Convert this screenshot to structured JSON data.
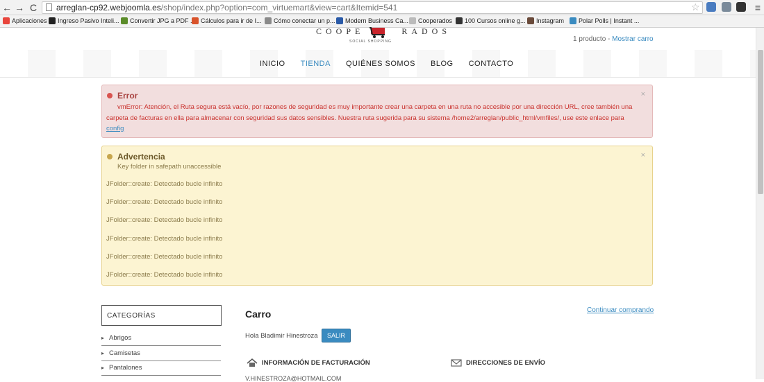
{
  "browser": {
    "url_host": "arreglan-cp92.webjoomla.es",
    "url_path": "/shop/index.php?option=com_virtuemart&view=cart&Itemid=541",
    "bookmarks": [
      {
        "label": "Aplicaciones",
        "color": "#e8453c"
      },
      {
        "label": "Ingreso Pasivo Inteli...",
        "color": "#222222"
      },
      {
        "label": "Convertir JPG a PDF ...",
        "color": "#5b8c2a"
      },
      {
        "label": "Cálculos para ir de I...",
        "color": "#d9532b"
      },
      {
        "label": "Cómo conectar un p...",
        "color": "#8a8a8a"
      },
      {
        "label": "Modern Business Ca...",
        "color": "#2a5aa8"
      },
      {
        "label": "Cooperados",
        "color": "#bbbbbb"
      },
      {
        "label": "100 Cursos online g...",
        "color": "#333333"
      },
      {
        "label": "Instagram",
        "color": "#6a4a3a"
      },
      {
        "label": "Polar Polls | Instant ...",
        "color": "#3a8bc0"
      }
    ]
  },
  "site": {
    "logo_left": "COOPE",
    "logo_right": "RADOS",
    "logo_tagline": "SOCIAL SHOPPING",
    "cart_count": "1 producto",
    "cart_separator": " - ",
    "cart_link": "Mostrar carro"
  },
  "menu": [
    "INICIO",
    "TIENDA",
    "QUIÉNES SOMOS",
    "BLOG",
    "CONTACTO"
  ],
  "error": {
    "title": "Error",
    "message": "vmError: Atención, el Ruta segura está vacío, por razones de seguridad es muy importante crear una carpeta en una ruta no accesible por una dirección URL, cree también una carpeta de facturas en ella para almacenar con seguridad sus datos sensibles. Nuestra ruta sugerida para su sistema /home2/arreglan/public_html/vmfiles/, use este enlace para ",
    "link": "config",
    "close": "×"
  },
  "warning": {
    "title": "Advertencia",
    "subtitle": "Key folder in safepath unaccessible",
    "lines": [
      "JFolder::create: Detectado bucle infinito",
      "JFolder::create: Detectado bucle infinito",
      "JFolder::create: Detectado bucle infinito",
      "JFolder::create: Detectado bucle infinito",
      "JFolder::create: Detectado bucle infinito",
      "JFolder::create: Detectado bucle infinito"
    ],
    "close": "×"
  },
  "sidebar": {
    "title": "CATEGORÍAS",
    "items": [
      "Abrigos",
      "Camisetas",
      "Pantalones"
    ]
  },
  "cart": {
    "title": "Carro",
    "continue": "Continuar comprando",
    "greeting": "Hola Bladimir Hinestroza",
    "logout": "SALIR",
    "billing_title": "INFORMACIÓN DE FACTURACIÓN",
    "shipping_title": "DIRECCIONES DE ENVÍO",
    "email_partial": "V.HINESTROZA@HOTMAIL.COM"
  }
}
